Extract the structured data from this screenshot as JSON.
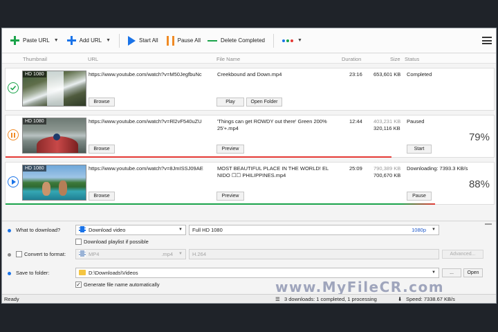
{
  "toolbar": {
    "paste_url": "Paste URL",
    "add_url": "Add URL",
    "start_all": "Start All",
    "pause_all": "Pause All",
    "delete_completed": "Delete Completed",
    "colors": {
      "green": "#1aa34a",
      "blue": "#1a73e8",
      "orange": "#f08a24"
    }
  },
  "columns": {
    "thumbnail": "Thumbnail",
    "url": "URL",
    "file_name": "File Name",
    "duration": "Duration",
    "size": "Size",
    "status": "Status"
  },
  "downloads": [
    {
      "state": "completed",
      "icon": "check-circle-icon",
      "quality": "HD 1080",
      "url": "https://www.youtube.com/watch?v=M50JegfbuNc",
      "file_name": "Creekbound and Down.mp4",
      "duration": "23:16",
      "size": "653,601 KB",
      "status": "Completed",
      "buttons": {
        "browse": "Browse",
        "play": "Play",
        "open_folder": "Open Folder"
      }
    },
    {
      "state": "paused",
      "icon": "pause-circle-icon",
      "quality": "HD 1080",
      "url": "https://www.youtube.com/watch?v=Rl2vF540uZU",
      "file_name_line1": "'Things can get ROWDY out there'  Green 200%",
      "file_name_line2": "25'+.mp4",
      "duration": "12:44",
      "size_total": "403,231 KB",
      "size_done": "320,116 KB",
      "status": "Paused",
      "percent": "79%",
      "progress": 0.79,
      "buttons": {
        "browse": "Browse",
        "preview": "Preview",
        "action": "Start"
      }
    },
    {
      "state": "downloading",
      "icon": "play-circle-icon",
      "quality": "HD 1080",
      "url": "https://www.youtube.com/watch?v=8JmISSJ09AE",
      "file_name_line1": "MOST BEAUTIFUL PLACE IN THE WORLD! EL",
      "file_name_line2": "NIDO ☐☐ PHILIPPINES.mp4",
      "duration": "25:09",
      "size_total": "790,389 KB",
      "size_done": "700,670 KB",
      "status": "Downloading: 7393.3 KB/s",
      "percent": "88%",
      "progress": 0.88,
      "buttons": {
        "browse": "Browse",
        "preview": "Preview",
        "action": "Pause"
      }
    }
  ],
  "options": {
    "what_label": "What to download?",
    "what_value": "Download video",
    "quality_value": "Full HD 1080",
    "quality_res": "1080p",
    "playlist_label": "Download playlist if possible",
    "convert_label": "Convert to format:",
    "format_value": "MP4",
    "format_ext": ".mp4",
    "codec_value": "H.264",
    "advanced_label": "Advanced...",
    "save_label": "Save to folder:",
    "folder_value": "D:\\Downloads\\Videos",
    "browse_label": "...",
    "open_label": "Open",
    "auto_name_label": "Generate file name automatically"
  },
  "watermark": "www.MyFileCR.com",
  "statusbar": {
    "ready": "Ready",
    "summary": "3 downloads: 1 completed, 1 processing",
    "speed": "Speed: 7338.67 KB/s"
  }
}
